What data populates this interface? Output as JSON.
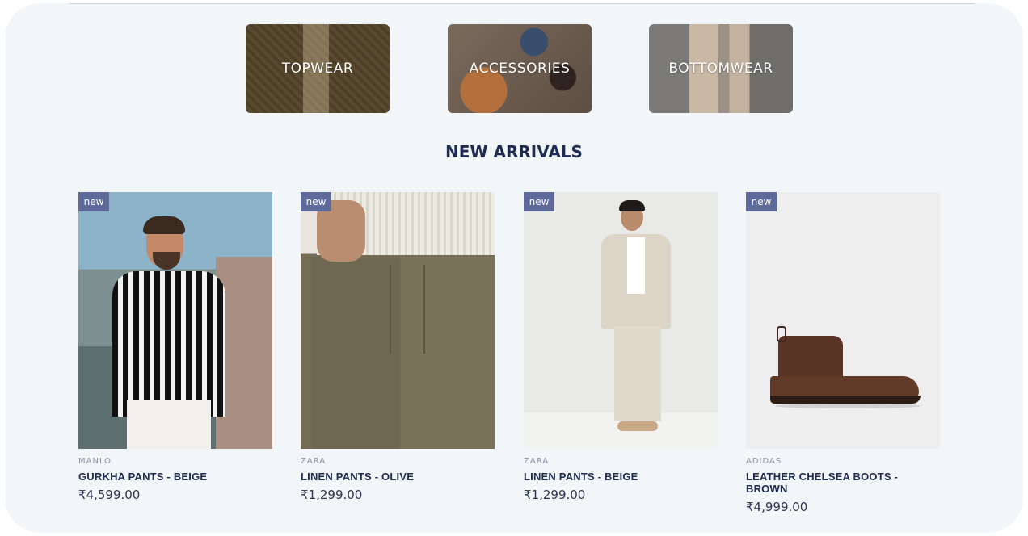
{
  "categories": [
    {
      "label": "TOPWEAR"
    },
    {
      "label": "ACCESSORIES"
    },
    {
      "label": "BOTTOMWEAR"
    }
  ],
  "section": {
    "title": "NEW ARRIVALS"
  },
  "products": [
    {
      "badge": "new",
      "brand": "MANLO",
      "name": "GURKHA PANTS - BEIGE",
      "price": "₹4,599.00"
    },
    {
      "badge": "new",
      "brand": "ZARA",
      "name": "LINEN PANTS - OLIVE",
      "price": "₹1,299.00"
    },
    {
      "badge": "new",
      "brand": "ZARA",
      "name": "LINEN PANTS - BEIGE",
      "price": "₹1,299.00"
    },
    {
      "badge": "new",
      "brand": "ADIDAS",
      "name": "LEATHER CHELSEA BOOTS - BROWN",
      "price": "₹4,999.00"
    }
  ],
  "colors": {
    "accent": "#1e2b52",
    "badge": "#5e6a9a",
    "page_bg": "#f3f6f8"
  }
}
